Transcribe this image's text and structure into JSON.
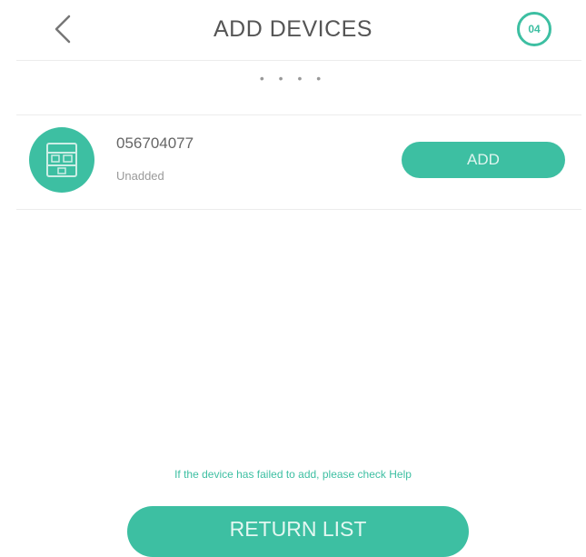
{
  "header": {
    "title": "ADD DEVICES",
    "badge": "04"
  },
  "progress": {
    "dots": "• • • •"
  },
  "device": {
    "id": "056704077",
    "status": "Unadded",
    "add_label": "ADD",
    "icon": "device-panel-icon"
  },
  "footer": {
    "help_text": "If the device has failed to add, please check Help",
    "return_label": "RETURN LIST"
  },
  "colors": {
    "accent": "#3dbfa2",
    "text": "#555555",
    "divider": "#ececec"
  }
}
